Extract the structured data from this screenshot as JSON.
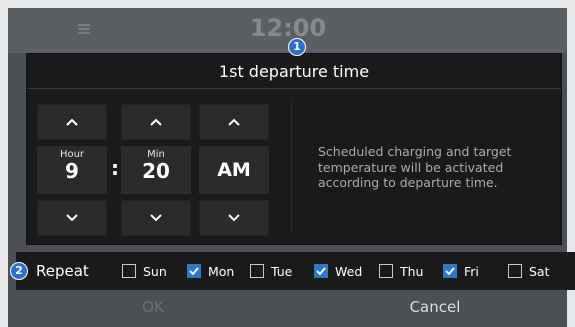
{
  "background": {
    "clock": "12:00"
  },
  "dialog": {
    "title": "1st departure time",
    "hour": {
      "label": "Hour",
      "value": "9"
    },
    "minute": {
      "label": "Min",
      "value": "20"
    },
    "separator": ":",
    "period": {
      "value": "AM"
    },
    "info_text": "Scheduled charging and target temperature will be activated according to departure time."
  },
  "markers": {
    "one": "1",
    "two": "2"
  },
  "repeat": {
    "label": "Repeat",
    "days": [
      {
        "label": "Sun",
        "checked": false
      },
      {
        "label": "Mon",
        "checked": true
      },
      {
        "label": "Tue",
        "checked": false
      },
      {
        "label": "Wed",
        "checked": true
      },
      {
        "label": "Thu",
        "checked": false
      },
      {
        "label": "Fri",
        "checked": true
      },
      {
        "label": "Sat",
        "checked": false
      }
    ]
  },
  "footer": {
    "ok": "OK",
    "cancel": "Cancel"
  },
  "colors": {
    "accent": "#2f78c9",
    "marker": "#2b6fcf",
    "panel": "#1a1a1a",
    "button": "#2b2b2b"
  }
}
